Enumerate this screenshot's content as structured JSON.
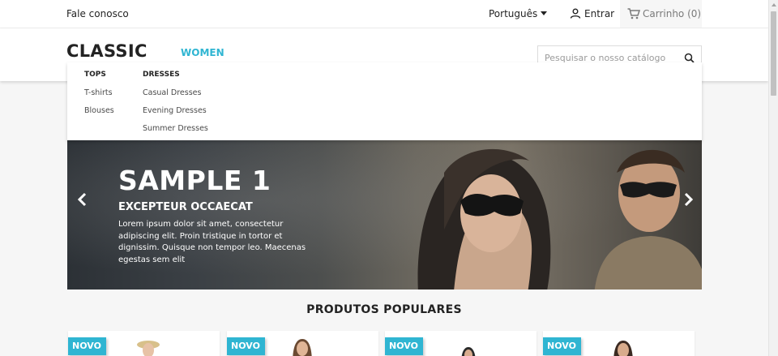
{
  "topbar": {
    "contact": "Fale conosco",
    "language": "Português",
    "signin": "Entrar",
    "cart": "Carrinho (0)"
  },
  "header": {
    "logo": "CLASSIC",
    "nav_women": "WOMEN",
    "search_placeholder": "Pesquisar o nosso catálogo"
  },
  "dropdown": {
    "columns": [
      {
        "title": "TOPS",
        "items": [
          "T-shirts",
          "Blouses"
        ]
      },
      {
        "title": "DRESSES",
        "items": [
          "Casual Dresses",
          "Evening Dresses",
          "Summer Dresses"
        ]
      }
    ]
  },
  "slider": {
    "title": "SAMPLE 1",
    "subtitle": "EXCEPTEUR OCCAECAT",
    "text": "Lorem ipsum dolor sit amet, consectetur adipiscing elit. Proin tristique in tortor et dignissim. Quisque non tempor leo. Maecenas egestas sem elit"
  },
  "section_title": "PRODUTOS POPULARES",
  "products": [
    {
      "badge": "NOVO"
    },
    {
      "badge": "NOVO"
    },
    {
      "badge": "NOVO"
    },
    {
      "badge": "NOVO"
    }
  ],
  "colors": {
    "accent": "#2fb5d2",
    "text": "#232323",
    "background": "#f6f6f6"
  },
  "icons": [
    "caret-down-icon",
    "person-icon",
    "cart-icon",
    "search-icon",
    "chevron-left-icon",
    "chevron-right-icon"
  ]
}
